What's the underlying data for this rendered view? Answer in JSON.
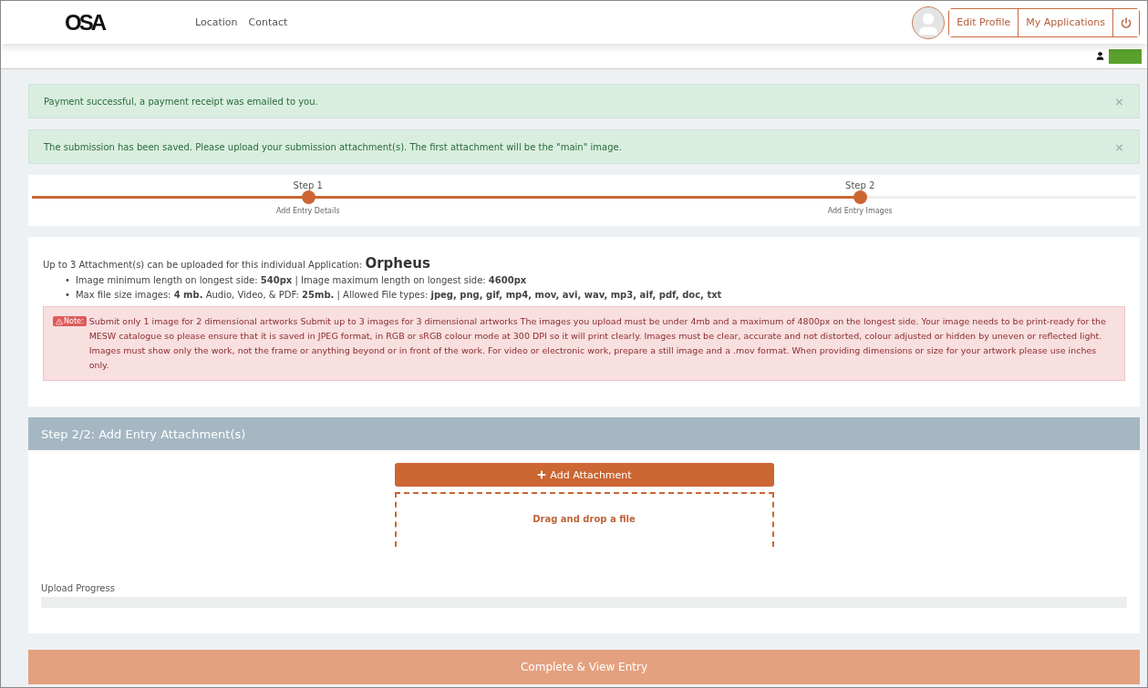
{
  "header": {
    "logo": "OSA",
    "nav": [
      "Location",
      "Contact"
    ],
    "buttons": [
      {
        "kind": "text",
        "label": "Edit Profile"
      },
      {
        "kind": "text",
        "label": "My Applications"
      },
      {
        "kind": "power"
      }
    ]
  },
  "alerts": [
    {
      "text": "Payment successful, a payment receipt was emailed to you.",
      "close": "×"
    },
    {
      "text": "The submission has been saved. Please upload your submission attachment(s). The first attachment will be the \"main\" image.",
      "close": "×"
    }
  ],
  "steps": [
    {
      "title": "Step 1",
      "caption": "Add Entry Details",
      "level": 1
    },
    {
      "title": "Step 2",
      "caption": "Add Entry Images",
      "level": 0.5
    }
  ],
  "info": {
    "intro": "Up to 3 Attachment(s) can be uploaded for this individual Application: ",
    "application": "Orpheus",
    "bullet": "•",
    "bullets": [
      "Image minimum length on longest side: **540px** | Image maximum length on longest side: **4600px**",
      "Max file size images: **4 mb.** Audio, Video, & PDF: **25mb.** | Allowed File types: **jpeg, png, gif, mp4, mov, avi, wav, mp3, aif, pdf, doc, txt**"
    ],
    "note_badge": "Note:",
    "note": "Submit only 1 image for 2 dimensional artworks Submit up to 3 images for 3 dimensional artworks The images you upload must be under 4mb and a maximum of 4800px on the longest side. Your image needs to be print-ready for the MESW catalogue so please ensure that it is saved in JPEG format, in RGB or sRGB colour mode at 300 DPI so it will print clearly. Images must be clear, accurate and not distorted, colour adjusted or hidden by uneven or reflected light. Images must show only the work, not the frame or anything beyond or in front of the work. For video or electronic work, prepare a still image and a .mov format. When providing dimensions or size for your artwork please use inches only."
  },
  "attachments": {
    "title": "Step 2/2: Add Entry Attachment(s)",
    "add_button": "Add Attachment",
    "dropzone": "Drag and drop a file",
    "progress_label": "Upload Progress",
    "level": 0
  },
  "complete_button": "Complete & View Entry"
}
